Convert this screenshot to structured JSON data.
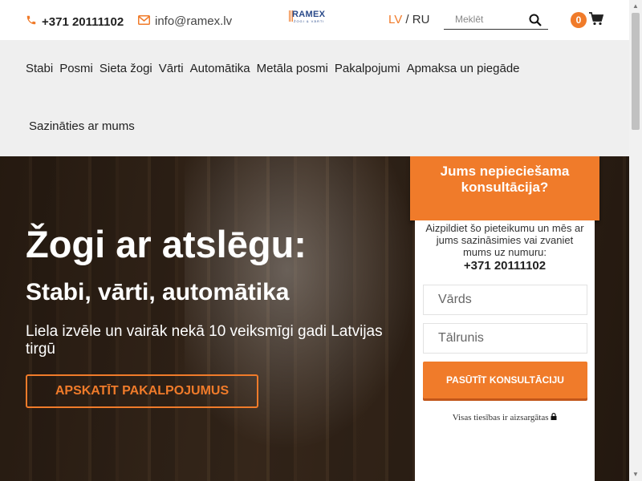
{
  "header": {
    "phone": "+371 20111102",
    "email": "info@ramex.lv",
    "logo_text": "RAMEX",
    "logo_sub": "ŽOGI & VĀRTI",
    "lang_active": "LV",
    "lang_sep": "/",
    "lang_other": "RU",
    "search_placeholder": "Meklēt",
    "cart_count": "0",
    "icons": {
      "phone": "phone-icon",
      "email": "envelope-icon",
      "search": "search-icon",
      "cart": "cart-icon",
      "lock": "lock-icon"
    },
    "accent_color": "#f07b2a"
  },
  "nav": {
    "items": [
      "Stabi",
      "Posmi",
      "Sieta žogi",
      "Vārti",
      "Automātika",
      "Metāla posmi",
      "Pakalpojumi",
      "Apmaksa un piegāde",
      "Sazināties ar mums"
    ]
  },
  "hero": {
    "title": "Žogi ar atslēgu:",
    "subtitle": "Stabi, vārti, automātika",
    "text": "Liela izvēle un vairāk nekā 10 veiksmīgi gadi Latvijas tirgū",
    "button": "APSKATĪT PAKALPOJUMUS"
  },
  "form": {
    "title": "Jums nepieciešama konsultācija?",
    "intro": "Aizpildiet šo pieteikumu un mēs ar jums sazināsimies vai zvaniet mums uz numuru:",
    "phone": "+371 20111102",
    "name_placeholder": "Vārds",
    "phone_placeholder": "Tālrunis",
    "submit": "PASŪTĪT KONSULTĀCIJU",
    "rights": "Visas tiesības ir aizsargātas"
  }
}
